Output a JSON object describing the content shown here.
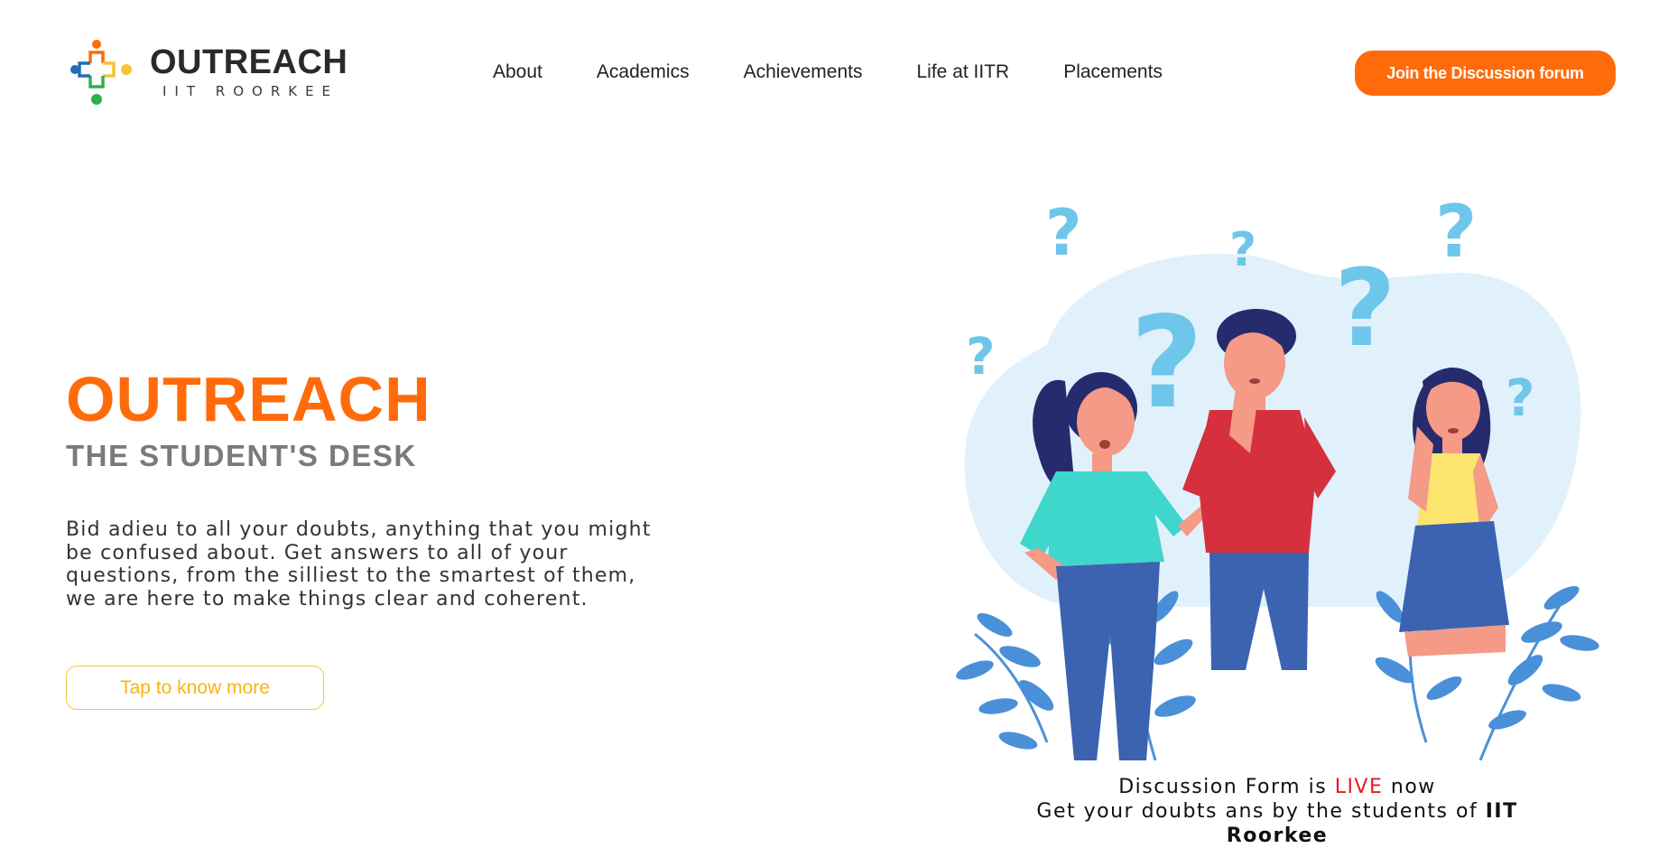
{
  "header": {
    "logo_title": "OUTREACH",
    "logo_subtitle": "IIT ROORKEE",
    "nav": [
      "About",
      "Academics",
      "Achievements",
      "Life at IITR",
      "Placements"
    ],
    "cta_label": "Join the Discussion forum"
  },
  "hero": {
    "title": "OUTREACH",
    "subtitle": "THE STUDENT'S DESK",
    "description": "Bid adieu to all your doubts, anything that you might be confused about. Get answers to all of your questions, from the silliest to the smartest of them, we are here to make things clear and coherent.",
    "button_label": "Tap to know more"
  },
  "notice": {
    "line1_prefix": "Discussion Form is",
    "line1_highlight": "LIVE",
    "line1_suffix": "now",
    "line2_prefix": "Get your doubts ans by the students of",
    "line2_bold": "IIT Roorkee"
  },
  "colors": {
    "accent": "#ff6b0a",
    "button_outline": "#f7c33c",
    "live_red": "#e31b1b",
    "blob": "#e0f1fb",
    "question_mark": "#6ec6ea",
    "leaves": "#4a90d9"
  },
  "icons": {
    "logo": "outreach-plus-logo-icon",
    "illustration": "confused-students-illustration"
  }
}
